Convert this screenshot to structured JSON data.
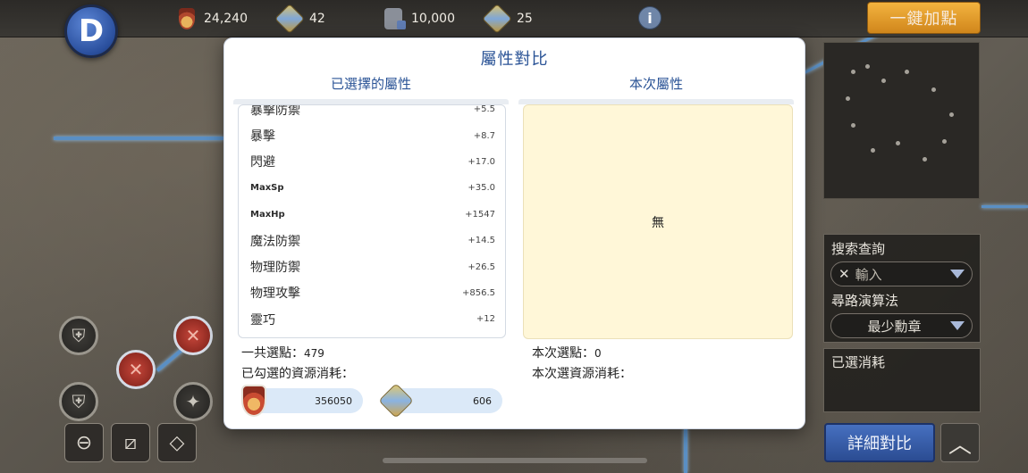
{
  "topbar": {
    "back_label": "D",
    "resources": [
      {
        "icon": "medal-icon",
        "value": "24,240"
      },
      {
        "icon": "gem-icon",
        "value": "42"
      },
      {
        "icon": "locked-medal-icon",
        "value": "10,000"
      },
      {
        "icon": "locked-gem-icon",
        "value": "25"
      }
    ],
    "info_label": "i",
    "auto_assign_label": "一鍵加點"
  },
  "side": {
    "search_label": "搜索查詢",
    "search_placeholder": "輸入",
    "algo_label": "尋路演算法",
    "algo_value": "最少勳章",
    "selected_cost_label": "已選消耗",
    "detail_compare_label": "詳細對比",
    "up_label": "︿"
  },
  "tools": {
    "zoom_out": "⊖",
    "slash": "⧄",
    "path": "◇"
  },
  "modal": {
    "title": "屬性對比",
    "left_header": "已選擇的屬性",
    "right_header": "本次屬性",
    "attributes": [
      {
        "name": "暴擊防禦",
        "value": "+5.5"
      },
      {
        "name": "暴擊",
        "value": "+8.7"
      },
      {
        "name": "閃避",
        "value": "+17.0"
      },
      {
        "name": "MaxSp",
        "value": "+35.0"
      },
      {
        "name": "MaxHp",
        "value": "+1547"
      },
      {
        "name": "魔法防禦",
        "value": "+14.5"
      },
      {
        "name": "物理防禦",
        "value": "+26.5"
      },
      {
        "name": "物理攻擊",
        "value": "+856.5"
      },
      {
        "name": "靈巧",
        "value": "+12"
      }
    ],
    "current_empty": "無",
    "total_label": "一共選點：",
    "total_value": "479",
    "checked_cost_label": "已勾選的資源消耗：",
    "current_points_label": "本次選點：",
    "current_points_value": "0",
    "current_cost_label": "本次選資源消耗：",
    "cost_medal": "356050",
    "cost_gem": "606"
  }
}
